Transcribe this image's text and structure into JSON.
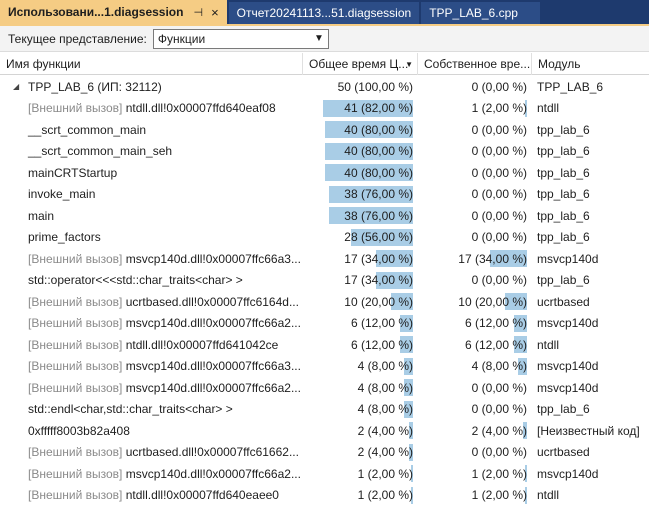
{
  "tabs": [
    {
      "label": "Использовани...1.diagsession",
      "active": true,
      "pin": "⊣",
      "close": "×"
    },
    {
      "label": "Отчет20241113...51.diagsession",
      "active": false
    },
    {
      "label": "TPP_LAB_6.cpp",
      "active": false
    }
  ],
  "view": {
    "label": "Текущее представление:",
    "selected": "Функции"
  },
  "columns": {
    "name": "Имя функции",
    "total": "Общее время Ц...",
    "self": "Собственное вре...",
    "module": "Модуль"
  },
  "colors": {
    "bar": "#a9cde6",
    "tab_active": "#f5cc84",
    "tabstrip": "#1e3a6e"
  },
  "rows": [
    {
      "prefix": "",
      "name": "TPP_LAB_6 (ИП: 32112)",
      "total": "50 (100,00 %)",
      "total_pct": 100,
      "self": "0 (0,00 %)",
      "self_pct": 0,
      "module": "TPP_LAB_6",
      "root": true
    },
    {
      "prefix": "[Внешний вызов]",
      "name": "ntdll.dll!0x00007ffd640eaf08",
      "total": "41 (82,00 %)",
      "total_pct": 82,
      "self": "1 (2,00 %)",
      "self_pct": 2,
      "module": "ntdll"
    },
    {
      "prefix": "",
      "name": "__scrt_common_main",
      "total": "40 (80,00 %)",
      "total_pct": 80,
      "self": "0 (0,00 %)",
      "self_pct": 0,
      "module": "tpp_lab_6"
    },
    {
      "prefix": "",
      "name": "__scrt_common_main_seh",
      "total": "40 (80,00 %)",
      "total_pct": 80,
      "self": "0 (0,00 %)",
      "self_pct": 0,
      "module": "tpp_lab_6"
    },
    {
      "prefix": "",
      "name": "mainCRTStartup",
      "total": "40 (80,00 %)",
      "total_pct": 80,
      "self": "0 (0,00 %)",
      "self_pct": 0,
      "module": "tpp_lab_6"
    },
    {
      "prefix": "",
      "name": "invoke_main",
      "total": "38 (76,00 %)",
      "total_pct": 76,
      "self": "0 (0,00 %)",
      "self_pct": 0,
      "module": "tpp_lab_6"
    },
    {
      "prefix": "",
      "name": "main",
      "total": "38 (76,00 %)",
      "total_pct": 76,
      "self": "0 (0,00 %)",
      "self_pct": 0,
      "module": "tpp_lab_6"
    },
    {
      "prefix": "",
      "name": "prime_factors",
      "total": "28 (56,00 %)",
      "total_pct": 56,
      "self": "0 (0,00 %)",
      "self_pct": 0,
      "module": "tpp_lab_6"
    },
    {
      "prefix": "[Внешний вызов]",
      "name": "msvcp140d.dll!0x00007ffc66a3...",
      "total": "17 (34,00 %)",
      "total_pct": 34,
      "self": "17 (34,00 %)",
      "self_pct": 34,
      "module": "msvcp140d"
    },
    {
      "prefix": "",
      "name": "std::operator<<<std::char_traits<char> >",
      "total": "17 (34,00 %)",
      "total_pct": 34,
      "self": "0 (0,00 %)",
      "self_pct": 0,
      "module": "tpp_lab_6"
    },
    {
      "prefix": "[Внешний вызов]",
      "name": "ucrtbased.dll!0x00007ffc6164d...",
      "total": "10 (20,00 %)",
      "total_pct": 20,
      "self": "10 (20,00 %)",
      "self_pct": 20,
      "module": "ucrtbased"
    },
    {
      "prefix": "[Внешний вызов]",
      "name": "msvcp140d.dll!0x00007ffc66a2...",
      "total": "6 (12,00 %)",
      "total_pct": 12,
      "self": "6 (12,00 %)",
      "self_pct": 12,
      "module": "msvcp140d"
    },
    {
      "prefix": "[Внешний вызов]",
      "name": "ntdll.dll!0x00007ffd641042ce",
      "total": "6 (12,00 %)",
      "total_pct": 12,
      "self": "6 (12,00 %)",
      "self_pct": 12,
      "module": "ntdll"
    },
    {
      "prefix": "[Внешний вызов]",
      "name": "msvcp140d.dll!0x00007ffc66a3...",
      "total": "4 (8,00 %)",
      "total_pct": 8,
      "self": "4 (8,00 %)",
      "self_pct": 8,
      "module": "msvcp140d"
    },
    {
      "prefix": "[Внешний вызов]",
      "name": "msvcp140d.dll!0x00007ffc66a2...",
      "total": "4 (8,00 %)",
      "total_pct": 8,
      "self": "0 (0,00 %)",
      "self_pct": 0,
      "module": "msvcp140d"
    },
    {
      "prefix": "",
      "name": "std::endl<char,std::char_traits<char> >",
      "total": "4 (8,00 %)",
      "total_pct": 8,
      "self": "0 (0,00 %)",
      "self_pct": 0,
      "module": "tpp_lab_6"
    },
    {
      "prefix": "",
      "name": "0xfffff8003b82a408",
      "total": "2 (4,00 %)",
      "total_pct": 4,
      "self": "2 (4,00 %)",
      "self_pct": 4,
      "module": "[Неизвестный код]"
    },
    {
      "prefix": "[Внешний вызов]",
      "name": "ucrtbased.dll!0x00007ffc61662...",
      "total": "2 (4,00 %)",
      "total_pct": 4,
      "self": "0 (0,00 %)",
      "self_pct": 0,
      "module": "ucrtbased"
    },
    {
      "prefix": "[Внешний вызов]",
      "name": "msvcp140d.dll!0x00007ffc66a2...",
      "total": "1 (2,00 %)",
      "total_pct": 2,
      "self": "1 (2,00 %)",
      "self_pct": 2,
      "module": "msvcp140d"
    },
    {
      "prefix": "[Внешний вызов]",
      "name": "ntdll.dll!0x00007ffd640eaee0",
      "total": "1 (2,00 %)",
      "total_pct": 2,
      "self": "1 (2,00 %)",
      "self_pct": 2,
      "module": "ntdll"
    }
  ]
}
